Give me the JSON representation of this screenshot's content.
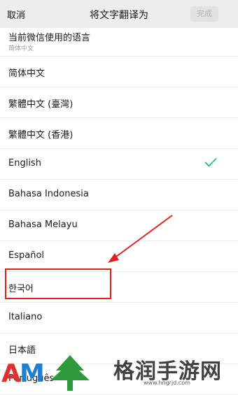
{
  "header": {
    "cancel_label": "取消",
    "title": "将文字翻译为",
    "done_label": "完成"
  },
  "languages": [
    {
      "label": "当前微信使用的语言",
      "sublabel": "简体中文"
    },
    {
      "label": "简体中文"
    },
    {
      "label": "繁體中文 (臺灣)"
    },
    {
      "label": "繁體中文 (香港)"
    },
    {
      "label": "English",
      "selected": true
    },
    {
      "label": "Bahasa Indonesia"
    },
    {
      "label": "Bahasa Melayu"
    },
    {
      "label": "Español"
    },
    {
      "label": "한국어",
      "highlighted": true
    },
    {
      "label": "Italiano"
    },
    {
      "label": "日本語"
    },
    {
      "label": "Português"
    }
  ],
  "colors": {
    "accent": "#07c160",
    "highlight": "#e02020",
    "nav_background": "#ededed"
  },
  "watermark": {
    "logo_text": "AM",
    "site_name": "格润手游网",
    "url": "www.hngrjd.com"
  }
}
